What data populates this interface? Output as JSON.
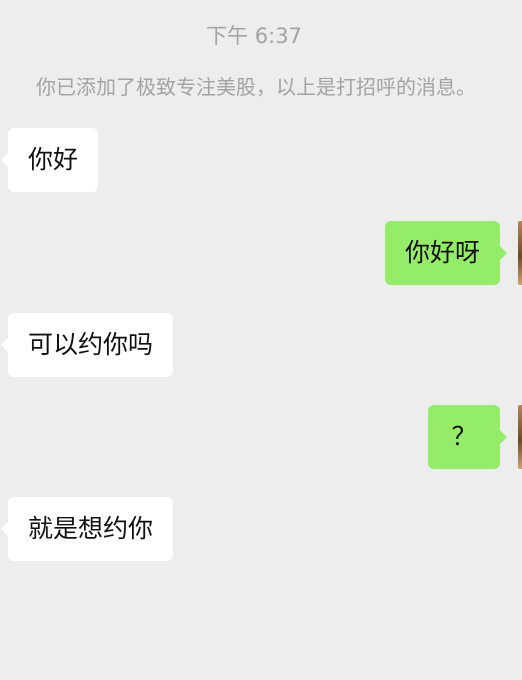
{
  "chat": {
    "timestamp": "下午 6:37",
    "system_note": "你已添加了极致专注美股，以上是打招呼的消息。",
    "messages": [
      {
        "side": "in",
        "text": "你好"
      },
      {
        "side": "out",
        "text": "你好呀"
      },
      {
        "side": "in",
        "text": "可以约你吗"
      },
      {
        "side": "out",
        "text": "？"
      },
      {
        "side": "in",
        "text": "就是想约你"
      }
    ]
  },
  "colors": {
    "background": "#ededed",
    "incoming_bubble": "#ffffff",
    "outgoing_bubble": "#95ec69",
    "meta_text": "#a3a3a3"
  }
}
